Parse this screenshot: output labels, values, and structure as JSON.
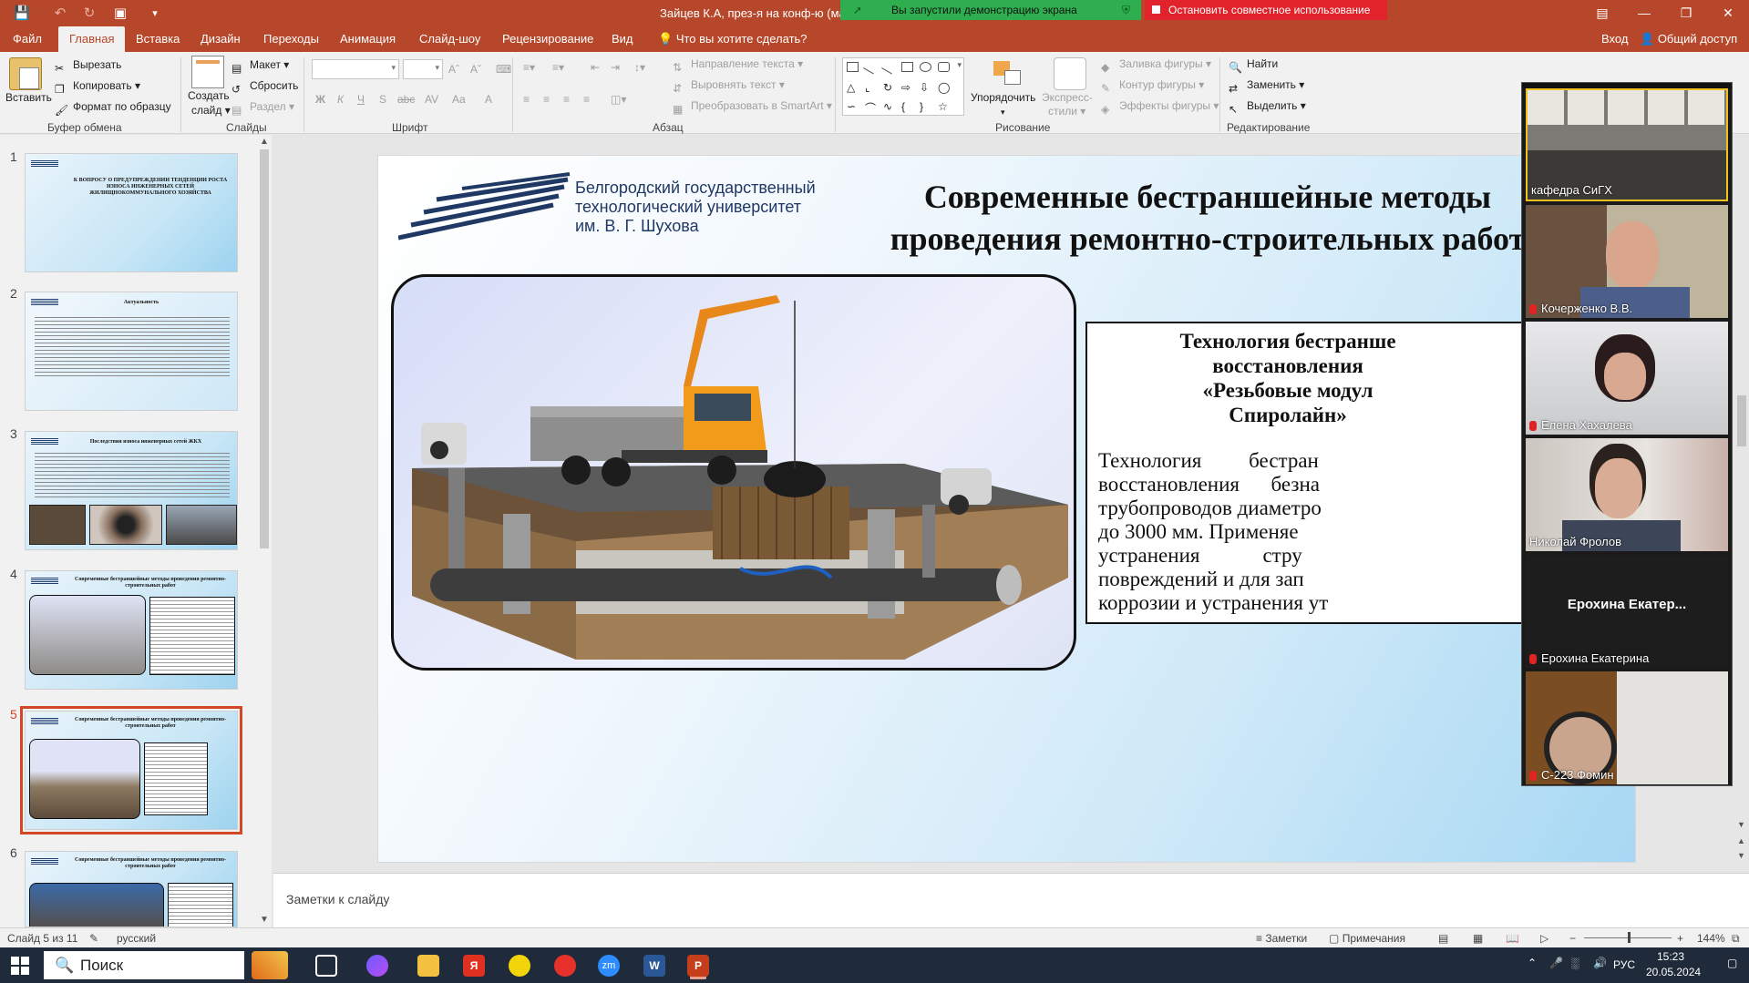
{
  "titlebar": {
    "doc_title": "Зайцев К.А, през-я на конф-ю (май",
    "share_banner": "Вы запустили демонстрацию экрана",
    "stop_share": "Остановить совместное использование"
  },
  "tabs": {
    "file": "Файл",
    "home": "Главная",
    "insert": "Вставка",
    "design": "Дизайн",
    "transitions": "Переходы",
    "animation": "Анимация",
    "slideshow": "Слайд-шоу",
    "review": "Рецензирование",
    "view": "Вид",
    "tell_me": "Что вы хотите сделать?",
    "signin": "Вход",
    "share": "Общий доступ"
  },
  "ribbon": {
    "clipboard": {
      "paste": "Вставить",
      "cut": "Вырезать",
      "copy": "Копировать",
      "format_painter": "Формат по образцу",
      "label": "Буфер обмена"
    },
    "slides": {
      "new_slide": "Создать",
      "new_slide2": "слайд",
      "layout": "Макет",
      "reset": "Сбросить",
      "section": "Раздел",
      "label": "Слайды"
    },
    "font": {
      "label": "Шрифт",
      "bold": "Ж",
      "italic": "К",
      "underline": "Ч",
      "shadow": "S",
      "strike": "abc",
      "spacing": "AV",
      "case": "Aa",
      "color": "A"
    },
    "paragraph": {
      "label": "Абзац",
      "text_dir": "Направление текста",
      "align_text": "Выровнять текст",
      "smartart": "Преобразовать в SmartArt"
    },
    "drawing": {
      "label": "Рисование",
      "arrange": "Упорядочить",
      "quick_styles": "Экспресс-",
      "quick_styles2": "стили",
      "fill": "Заливка фигуры",
      "outline": "Контур фигуры",
      "effects": "Эффекты фигуры"
    },
    "editing": {
      "label": "Редактирование",
      "find": "Найти",
      "replace": "Заменить",
      "select": "Выделить"
    }
  },
  "thumbnails": [
    {
      "num": "1",
      "title": "К ВОПРОСУ О ПРЕДУПРЕЖДЕНИИ ТЕНДЕНЦИИ РОСТА ИЗНОСА ИНЖЕНЕРНЫХ СЕТЕЙ ЖИЛИЩНОКОММУНАЛЬНОГО ХОЗЯЙСТВА"
    },
    {
      "num": "2",
      "title": "Актуальность"
    },
    {
      "num": "3",
      "title": "Последствия износа инженерных сетей ЖКХ"
    },
    {
      "num": "4",
      "title": "Современные бестраншейные методы проведения ремонтно-строительных работ"
    },
    {
      "num": "5",
      "title": "Современные бестраншейные методы проведения ремонтно-строительных работ"
    },
    {
      "num": "6",
      "title": "Современные бестраншейные методы проведения ремонтно-строительных работ"
    }
  ],
  "slide": {
    "university_line1": "Белгородский государственный",
    "university_line2": "технологический университет",
    "university_line3": "им. В. Г. Шухова",
    "title_line1": "Современные бестраншейные методы",
    "title_line2": "проведения ремонтно-строительных работ",
    "box_head1": "Технология бестранше",
    "box_head2": "восстановления",
    "box_head3": "«Резьбовые модул",
    "box_head4": "Спиролайн»",
    "box_body1": "Технология         бестран",
    "box_body2": "восстановления      безна",
    "box_body3": "трубопроводов диаметро",
    "box_body4": "до 3000 мм. Применяе",
    "box_body5": "устранения            стру",
    "box_body6": "повреждений и для зап",
    "box_body7": "коррозии и устранения ут"
  },
  "participants": [
    {
      "name": "кафедра СиГХ",
      "muted": false
    },
    {
      "name": "Кочерженко В.В.",
      "muted": true
    },
    {
      "name": "Елена Хахалева",
      "muted": true
    },
    {
      "name": "Николай Фролов",
      "muted": false
    },
    {
      "name": "Ерохина Екатерина",
      "muted": true,
      "placeholder": "Ерохина  Екатер..."
    },
    {
      "name": "С-223 Фомин",
      "muted": true
    }
  ],
  "notes_placeholder": "Заметки к слайду",
  "statusbar": {
    "slide_info": "Слайд 5 из 11",
    "language": "русский",
    "notes": "Заметки",
    "comments": "Примечания",
    "zoom": "144%"
  },
  "taskbar": {
    "search": "Поиск",
    "lang": "РУС",
    "time": "15:23",
    "date": "20.05.2024"
  },
  "colors": {
    "accent": "#b7472a",
    "share_green": "#2eae4f",
    "stop_red": "#e1242b"
  }
}
